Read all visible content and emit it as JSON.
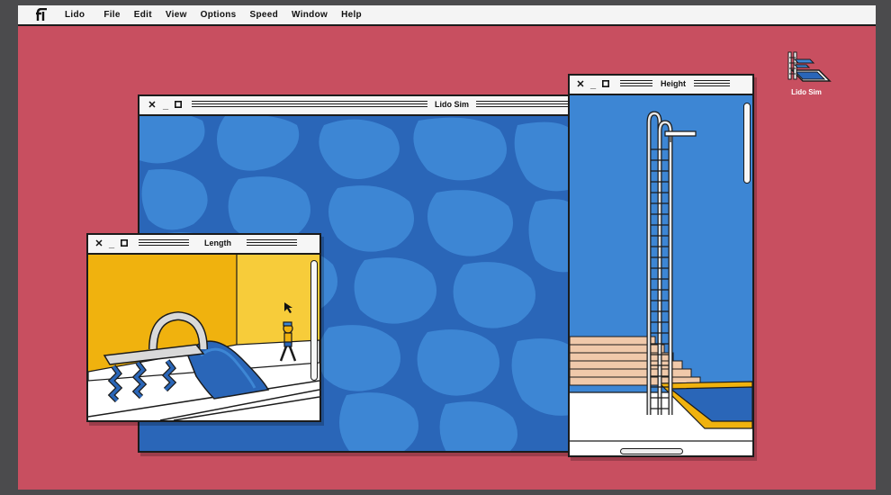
{
  "menubar": {
    "logo_icon": "lido-logo-icon",
    "app_name": "Lido",
    "items": [
      "File",
      "Edit",
      "View",
      "Options",
      "Speed",
      "Window",
      "Help"
    ]
  },
  "desktop": {
    "background": "#c84f60",
    "icon": {
      "label": "Lido Sim",
      "icon": "diving-pool-icon"
    }
  },
  "windows": {
    "main": {
      "title": "Lido Sim"
    },
    "length": {
      "title": "Length"
    },
    "height": {
      "title": "Height"
    }
  },
  "colors": {
    "water_light": "#3d86d4",
    "water_dark": "#2a66b8",
    "sand": "#f0b20e",
    "sand_light": "#f7cc3a",
    "chrome": "#1b1b1b",
    "peach_steps": "#f0c9aa"
  }
}
